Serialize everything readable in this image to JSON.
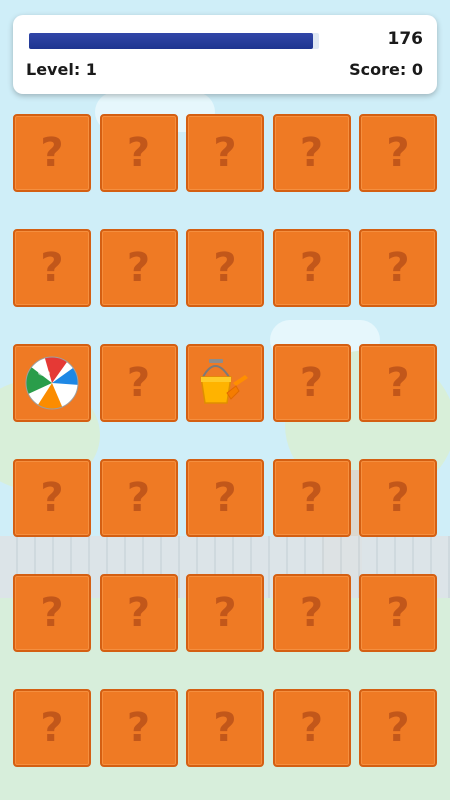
{
  "hud": {
    "timer_value": "176",
    "timer_fraction": 0.98,
    "level_text": "Level: 1",
    "score_text": "Score: 0"
  },
  "colors": {
    "card_back": "#ef7a24",
    "card_border": "#d45f12",
    "question_mark": "#c2571a",
    "timer_fill": "#1e3590"
  },
  "cards": [
    {
      "state": "hidden",
      "glyph": "?"
    },
    {
      "state": "hidden",
      "glyph": "?"
    },
    {
      "state": "hidden",
      "glyph": "?"
    },
    {
      "state": "hidden",
      "glyph": "?"
    },
    {
      "state": "hidden",
      "glyph": "?"
    },
    {
      "state": "hidden",
      "glyph": "?"
    },
    {
      "state": "hidden",
      "glyph": "?"
    },
    {
      "state": "hidden",
      "glyph": "?"
    },
    {
      "state": "hidden",
      "glyph": "?"
    },
    {
      "state": "hidden",
      "glyph": "?"
    },
    {
      "state": "revealed",
      "icon": "beach-ball-icon"
    },
    {
      "state": "hidden",
      "glyph": "?"
    },
    {
      "state": "revealed",
      "icon": "bucket-and-spade-icon"
    },
    {
      "state": "hidden",
      "glyph": "?"
    },
    {
      "state": "hidden",
      "glyph": "?"
    },
    {
      "state": "hidden",
      "glyph": "?"
    },
    {
      "state": "hidden",
      "glyph": "?"
    },
    {
      "state": "hidden",
      "glyph": "?"
    },
    {
      "state": "hidden",
      "glyph": "?"
    },
    {
      "state": "hidden",
      "glyph": "?"
    },
    {
      "state": "hidden",
      "glyph": "?"
    },
    {
      "state": "hidden",
      "glyph": "?"
    },
    {
      "state": "hidden",
      "glyph": "?"
    },
    {
      "state": "hidden",
      "glyph": "?"
    },
    {
      "state": "hidden",
      "glyph": "?"
    },
    {
      "state": "hidden",
      "glyph": "?"
    },
    {
      "state": "hidden",
      "glyph": "?"
    },
    {
      "state": "hidden",
      "glyph": "?"
    },
    {
      "state": "hidden",
      "glyph": "?"
    },
    {
      "state": "hidden",
      "glyph": "?"
    }
  ]
}
